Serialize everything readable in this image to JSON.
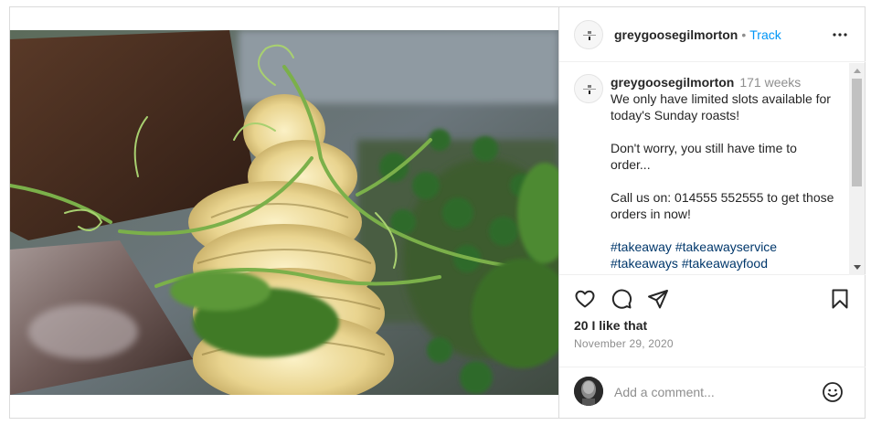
{
  "post": {
    "username": "greygoosegilmorton",
    "dot": "•",
    "follow_label": "Track",
    "caption": {
      "username": "greygoosegilmorton",
      "time": "171 weeks",
      "lines": [
        "We only have limited slots available for today's Sunday roasts!",
        "",
        "Don't worry, you still have time to order...",
        "",
        "Call us on: 014555 552555 to get those orders in now!",
        ""
      ],
      "hashtags_line1": "#takeaway #takeawayservice",
      "hashtags_line2": "#takeaways #takeawayfood"
    },
    "likes_text": "20 I like that",
    "date": "November 29, 2020",
    "comment_placeholder": "Add a comment..."
  },
  "icons": {
    "more": "more-options-icon",
    "like": "heart-icon",
    "comment": "comment-icon",
    "share": "share-icon",
    "save": "bookmark-icon",
    "emoji": "emoji-icon"
  },
  "colors": {
    "link": "#0095f6",
    "hashtag": "#00376b",
    "muted": "#8e8e8e",
    "text": "#262626"
  }
}
